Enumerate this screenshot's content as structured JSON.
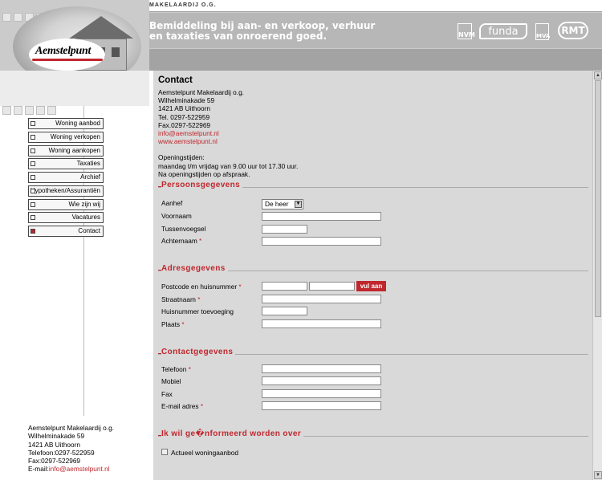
{
  "header": {
    "company_tag": "MAKELAARDIJ O.G.",
    "tagline_line1": "Bemiddeling bij aan- en verkoop, verhuur",
    "tagline_line2": "en taxaties van onroerend goed.",
    "logo_text": "Aemstelpunt",
    "logos": [
      "NVM",
      "funda",
      "MVA",
      "RMT"
    ]
  },
  "menu": [
    {
      "label": "Woning aanbod",
      "active": false
    },
    {
      "label": "Woning verkopen",
      "active": false
    },
    {
      "label": "Woning aankopen",
      "active": false
    },
    {
      "label": "Taxaties",
      "active": false
    },
    {
      "label": "Archief",
      "active": false
    },
    {
      "label": "Hypotheken/Assurantiën",
      "active": false
    },
    {
      "label": "Wie zijn wij",
      "active": false
    },
    {
      "label": "Vacatures",
      "active": false
    },
    {
      "label": "Contact",
      "active": true
    }
  ],
  "sidebar_address": {
    "name": "Aemstelpunt Makelaardij o.g.",
    "street": "Wilhelminakade 59",
    "city": "1421 AB Uithoorn",
    "phone": "Telefoon:0297-522959",
    "fax": "Fax:0297-522969",
    "email_label": "E-mail:",
    "email": "info@aemstelpunt.nl"
  },
  "contact": {
    "title": "Contact",
    "name": "Aemstelpunt Makelaardij o.g.",
    "street": "Wilhelminakade 59",
    "city": "1421 AB Uithoorn",
    "phone": "Tel. 0297-522959",
    "fax": "Fax.0297-522969",
    "email": "info@aemstelpunt.nl",
    "website": "www.aemstelpunt.nl",
    "hours_title": "Openingstijden:",
    "hours_line1": "maandag t/m vrijdag van 9.00 uur tot 17.30 uur.",
    "hours_line2": "Na openingstijden op afspraak."
  },
  "form": {
    "section_personal": "Persoonsgegevens",
    "aanhef_label": "Aanhef",
    "aanhef_value": "De heer",
    "voornaam_label": "Voornaam",
    "tussenvoegsel_label": "Tussenvoegsel",
    "achternaam_label": "Achternaam",
    "section_address": "Adresgegevens",
    "postcode_label": "Postcode en huisnummer",
    "fill_button": "vul aan",
    "straat_label": "Straatnaam",
    "toevoeging_label": "Huisnummer toevoeging",
    "plaats_label": "Plaats",
    "section_contact": "Contactgegevens",
    "telefoon_label": "Telefoon",
    "mobiel_label": "Mobiel",
    "fax_label": "Fax",
    "email_label": "E-mail adres",
    "section_info": "Ik wil ge�nformeerd worden over",
    "option_current": "Actueel woningaanbod",
    "required_mark": "*"
  }
}
